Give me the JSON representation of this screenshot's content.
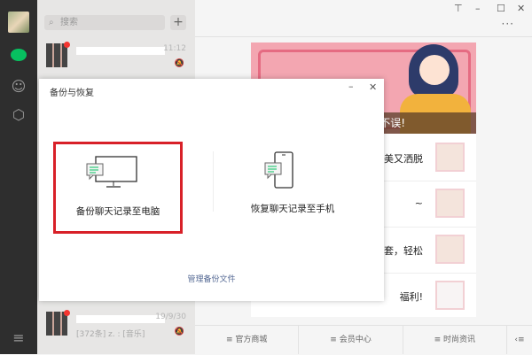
{
  "sidebar": {
    "items": [
      "avatar",
      "chat",
      "contacts",
      "mini-programs",
      "menu"
    ]
  },
  "chatlist": {
    "search_placeholder": "搜索",
    "rows": [
      {
        "time": "11:12",
        "message": ""
      },
      {
        "time": "19/9/30",
        "message": "[372条] z. : [音乐]"
      }
    ]
  },
  "window": {
    "controls": [
      "pin",
      "minimize",
      "maximize",
      "close"
    ]
  },
  "article": {
    "banner_caption": "不误!",
    "items": [
      {
        "title": "…又美又洒脱"
      },
      {
        "title": "~"
      },
      {
        "title": "外套，轻松"
      },
      {
        "title": "福利!"
      }
    ]
  },
  "menu": {
    "items": [
      "官方商城",
      "会员中心",
      "时尚资讯"
    ]
  },
  "dialog": {
    "title": "备份与恢复",
    "backup_label": "备份聊天记录至电脑",
    "restore_label": "恢复聊天记录至手机",
    "manage_link": "管理备份文件",
    "accent": "#d82028",
    "link_color": "#576b95"
  }
}
